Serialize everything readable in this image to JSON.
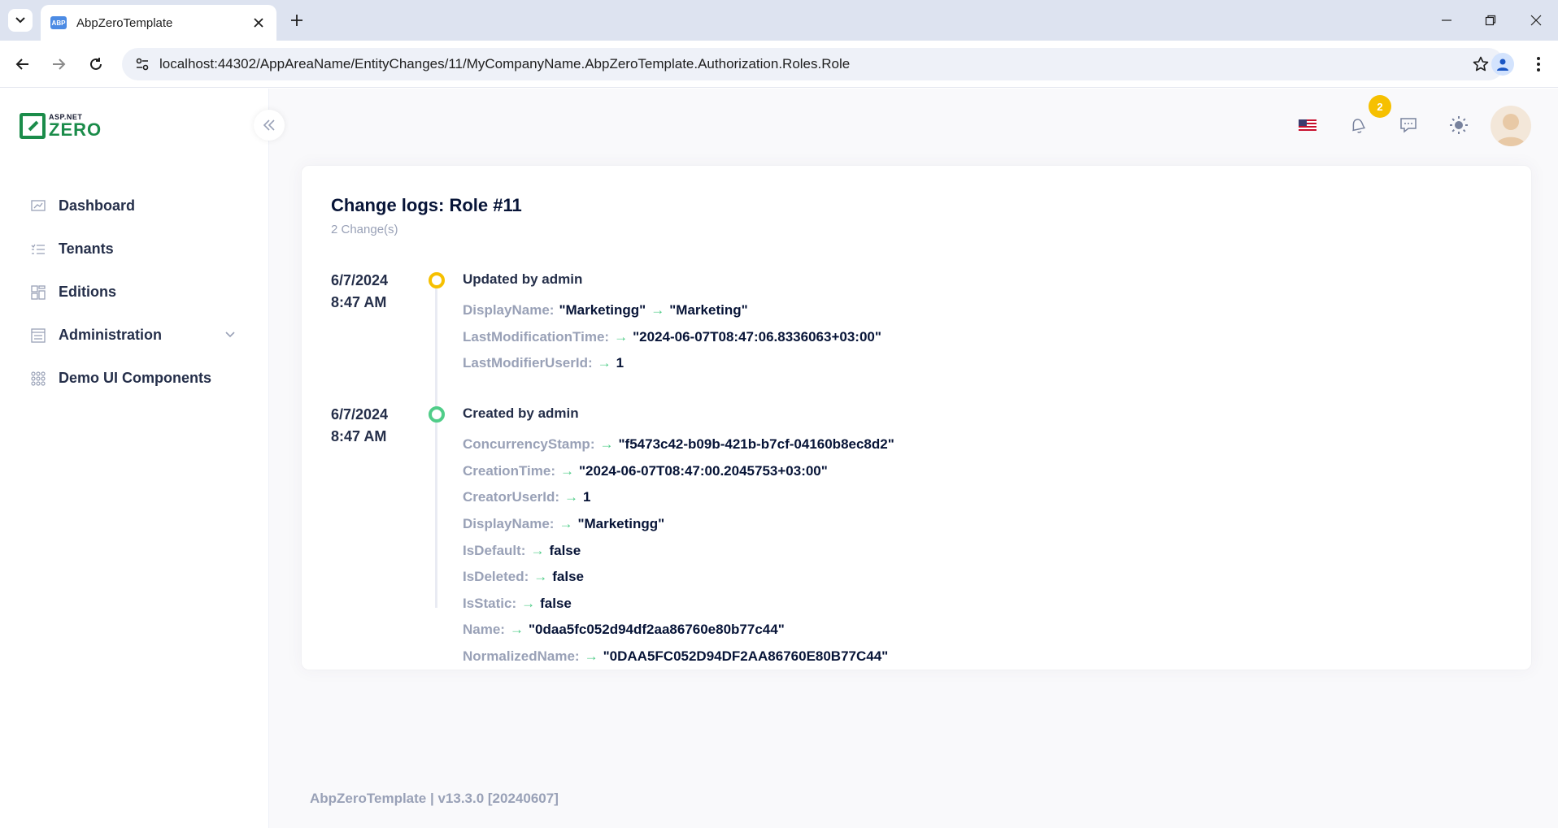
{
  "browser": {
    "tab_title": "AbpZeroTemplate",
    "favicon_text": "ABP",
    "url": "localhost:44302/AppAreaName/EntityChanges/11/MyCompanyName.AbpZeroTemplate.Authorization.Roles.Role"
  },
  "logo": {
    "small": "ASP.NET",
    "big": "ZERO"
  },
  "sidebar": {
    "items": [
      {
        "label": "Dashboard",
        "icon": "dashboard-icon"
      },
      {
        "label": "Tenants",
        "icon": "list-icon"
      },
      {
        "label": "Editions",
        "icon": "grid-icon"
      },
      {
        "label": "Administration",
        "icon": "admin-icon",
        "has_children": true
      },
      {
        "label": "Demo UI Components",
        "icon": "dots-grid-icon"
      }
    ]
  },
  "header": {
    "notification_count": "2"
  },
  "page": {
    "title": "Change logs: Role #11",
    "subtitle": "2 Change(s)"
  },
  "timeline": [
    {
      "date": "6/7/2024",
      "time": "8:47 AM",
      "title": "Updated by admin",
      "dot_color": "#f6c000",
      "changes": [
        {
          "prop": "DisplayName:",
          "old": "\"Marketingg\"",
          "new": "\"Marketing\""
        },
        {
          "prop": "LastModificationTime:",
          "old": "",
          "new": "\"2024-06-07T08:47:06.8336063+03:00\""
        },
        {
          "prop": "LastModifierUserId:",
          "old": "",
          "new": "1"
        }
      ]
    },
    {
      "date": "6/7/2024",
      "time": "8:47 AM",
      "title": "Created by admin",
      "dot_color": "#50cd89",
      "changes": [
        {
          "prop": "ConcurrencyStamp:",
          "old": "",
          "new": "\"f5473c42-b09b-421b-b7cf-04160b8ec8d2\""
        },
        {
          "prop": "CreationTime:",
          "old": "",
          "new": "\"2024-06-07T08:47:00.2045753+03:00\""
        },
        {
          "prop": "CreatorUserId:",
          "old": "",
          "new": "1"
        },
        {
          "prop": "DisplayName:",
          "old": "",
          "new": "\"Marketingg\""
        },
        {
          "prop": "IsDefault:",
          "old": "",
          "new": "false"
        },
        {
          "prop": "IsDeleted:",
          "old": "",
          "new": "false"
        },
        {
          "prop": "IsStatic:",
          "old": "",
          "new": "false"
        },
        {
          "prop": "Name:",
          "old": "",
          "new": "\"0daa5fc052d94df2aa86760e80b77c44\""
        },
        {
          "prop": "NormalizedName:",
          "old": "",
          "new": "\"0DAA5FC052D94DF2AA86760E80B77C44\""
        }
      ]
    }
  ],
  "arrow_glyph": "→",
  "footer": "AbpZeroTemplate | v13.3.0 [20240607]",
  "colors": {
    "accent": "#1b8c4a",
    "badge": "#f6c000",
    "arrow": "#50cd89"
  }
}
